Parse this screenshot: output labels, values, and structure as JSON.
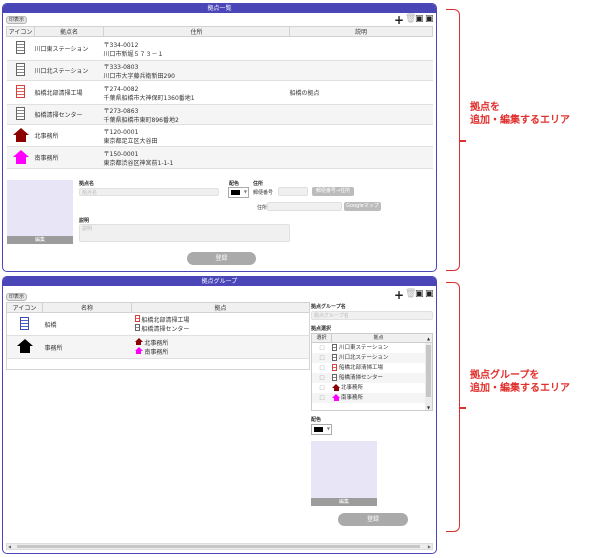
{
  "location_panel": {
    "title": "拠点一覧",
    "print_label": "印表示",
    "columns": [
      "アイコン",
      "拠点名",
      "住所",
      "説明"
    ],
    "rows": [
      {
        "icon": "building-gray-icon",
        "name": "川口東ステーション",
        "zip": "〒334-0012",
        "address": "川口市新堀５７３－１",
        "desc": ""
      },
      {
        "icon": "building-gray-icon",
        "name": "川口北ステーション",
        "zip": "〒333-0803",
        "address": "川口市大字藤兵衛新田290",
        "desc": ""
      },
      {
        "icon": "building-red-icon",
        "name": "船橋北部清掃工場",
        "zip": "〒274-0082",
        "address": "千葉県船橋市大神保町1360番地1",
        "desc": "船橋の拠点"
      },
      {
        "icon": "building-gray-icon",
        "name": "船橋清掃センター",
        "zip": "〒273-0863",
        "address": "千葉県船橋市東町896番地2",
        "desc": ""
      },
      {
        "icon": "house-darkred-icon",
        "name": "北事務所",
        "zip": "〒120-0001",
        "address": "東京都足立区大谷田",
        "desc": ""
      },
      {
        "icon": "house-magenta-icon",
        "name": "南事務所",
        "zip": "〒150-0001",
        "address": "東京都渋谷区神宮前1-1-1",
        "desc": ""
      }
    ],
    "form": {
      "name_label": "拠点名",
      "name_placeholder": "拠点名",
      "color_label": "配色",
      "address_label": "住所",
      "zip_label": "郵便番号",
      "zip_to_address_button": "郵便番号→住所",
      "address_sub_label": "住所",
      "google_map_button": "Googleマップ",
      "desc_label": "説明",
      "desc_placeholder": "説明",
      "edit_button": "編集",
      "register_button": "登録"
    }
  },
  "group_panel": {
    "title": "拠点グループ",
    "print_label": "印表示",
    "columns": [
      "アイコン",
      "名称",
      "拠点"
    ],
    "rows": [
      {
        "icon": "building-blue-icon",
        "name": "船橋",
        "members": [
          {
            "icon": "building-red-icon",
            "label": "船橋北部清掃工場"
          },
          {
            "icon": "building-gray-icon",
            "label": "船橋清掃センター"
          }
        ]
      },
      {
        "icon": "house-black-icon",
        "name": "事務所",
        "members": [
          {
            "icon": "house-darkred-icon",
            "label": "北事務所"
          },
          {
            "icon": "house-magenta-icon",
            "label": "南事務所"
          }
        ]
      }
    ],
    "form": {
      "group_name_label": "拠点グループ名",
      "group_name_placeholder": "拠点グループ名",
      "select_label": "拠点選択",
      "select_col": "選択",
      "location_col": "拠点",
      "options": [
        {
          "icon": "building-gray-icon",
          "label": "川口東ステーション"
        },
        {
          "icon": "building-gray-icon",
          "label": "川口北ステーション"
        },
        {
          "icon": "building-red-icon",
          "label": "船橋北部清掃工場"
        },
        {
          "icon": "building-gray-icon",
          "label": "船橋清掃センター"
        },
        {
          "icon": "house-darkred-icon",
          "label": "北事務所"
        },
        {
          "icon": "house-magenta-icon",
          "label": "南事務所"
        }
      ],
      "color_label": "配色",
      "edit_button": "編集",
      "register_button": "登録"
    }
  },
  "annotations": {
    "top_line1": "拠点を",
    "top_line2": "追加・編集するエリア",
    "bottom_line1": "拠点グループを",
    "bottom_line2": "追加・編集するエリア"
  },
  "colors": {
    "accent": "#4a46b8",
    "annotation": "#e0302d",
    "darkred": "#8b0000",
    "magenta": "#ff00ff"
  }
}
